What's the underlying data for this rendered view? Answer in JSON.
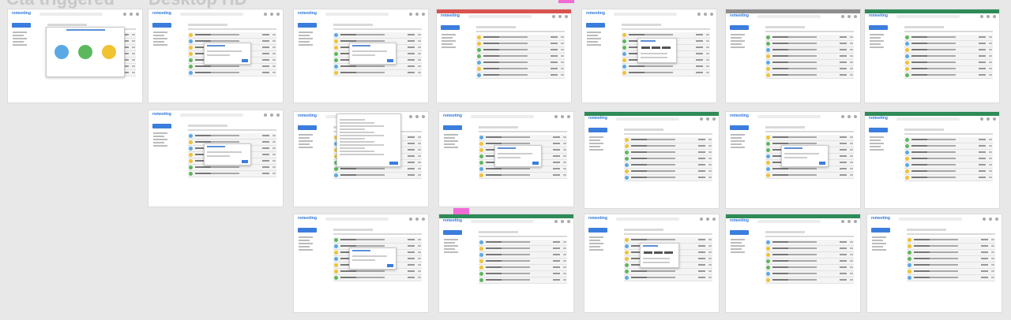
{
  "headings": [
    "Cta triggered",
    "Desktop HD"
  ],
  "logo": "remeeting",
  "compose_label": "Create Transcript",
  "colors": {
    "accent": "#2d75d8",
    "banner_red": "#d9534f",
    "banner_green": "#2e8b57",
    "banner_gray": "#8d8d8d",
    "pink": "#f06bd4",
    "avatar_blue": "#5aa9e6",
    "avatar_yellow": "#f1c232",
    "avatar_green": "#5cb85c"
  },
  "cards": [
    {
      "id": "r1c1",
      "banner": "none",
      "overlay": "cta"
    },
    {
      "id": "r1c2",
      "banner": "none",
      "overlay": "modal"
    },
    {
      "id": "r1c3",
      "banner": "none",
      "overlay": "modal"
    },
    {
      "id": "r1c4",
      "banner": "red",
      "overlay": "none"
    },
    {
      "id": "r1c5",
      "banner": "none",
      "overlay": "dropdown"
    },
    {
      "id": "r1c6",
      "banner": "gray",
      "overlay": "none"
    },
    {
      "id": "r1c7",
      "banner": "green",
      "overlay": "none"
    },
    {
      "id": "r2c2",
      "banner": "none",
      "overlay": "modal"
    },
    {
      "id": "r2c3",
      "banner": "none",
      "overlay": "filepicker"
    },
    {
      "id": "r2c4",
      "banner": "none",
      "overlay": "modal"
    },
    {
      "id": "r2c5",
      "banner": "green",
      "overlay": "none"
    },
    {
      "id": "r2c6",
      "banner": "none",
      "overlay": "modal"
    },
    {
      "id": "r2c7",
      "banner": "green",
      "overlay": "none"
    },
    {
      "id": "r3c3",
      "banner": "none",
      "overlay": "modal"
    },
    {
      "id": "r3c4",
      "banner": "green",
      "overlay": "none"
    },
    {
      "id": "r3c5",
      "banner": "none",
      "overlay": "dropdown"
    },
    {
      "id": "r3c6",
      "banner": "green",
      "overlay": "none"
    },
    {
      "id": "r3c7",
      "banner": "none",
      "overlay": "none"
    }
  ]
}
